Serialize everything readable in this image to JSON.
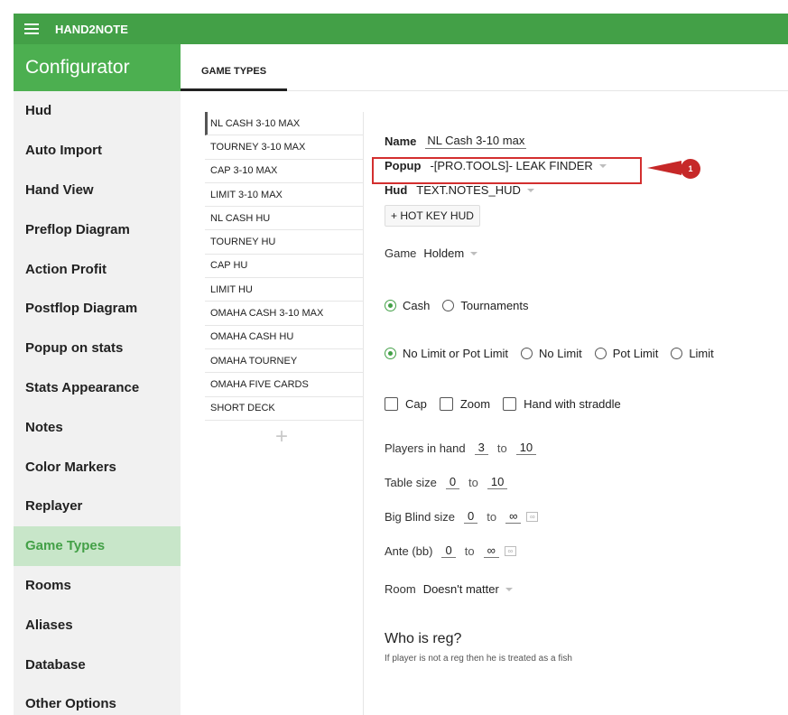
{
  "app": {
    "title": "HAND2NOTE"
  },
  "sidebar": {
    "title": "Configurator",
    "items": [
      {
        "label": "Hud"
      },
      {
        "label": "Auto Import"
      },
      {
        "label": "Hand View"
      },
      {
        "label": "Preflop Diagram"
      },
      {
        "label": "Action Profit"
      },
      {
        "label": "Postflop Diagram"
      },
      {
        "label": "Popup on stats"
      },
      {
        "label": "Stats Appearance"
      },
      {
        "label": "Notes"
      },
      {
        "label": "Color Markers"
      },
      {
        "label": "Replayer"
      },
      {
        "label": "Game Types",
        "active": true
      },
      {
        "label": "Rooms"
      },
      {
        "label": "Aliases"
      },
      {
        "label": "Database"
      },
      {
        "label": "Other Options"
      }
    ]
  },
  "tabs": [
    {
      "label": "GAME TYPES",
      "active": true
    }
  ],
  "game_types": [
    {
      "label": "NL CASH 3-10 MAX",
      "active": true
    },
    {
      "label": "TOURNEY 3-10 MAX"
    },
    {
      "label": "CAP 3-10 MAX"
    },
    {
      "label": "LIMIT 3-10 MAX"
    },
    {
      "label": "NL CASH HU"
    },
    {
      "label": "TOURNEY HU"
    },
    {
      "label": "CAP HU"
    },
    {
      "label": "LIMIT HU"
    },
    {
      "label": "OMAHA CASH 3-10 MAX"
    },
    {
      "label": "OMAHA CASH HU"
    },
    {
      "label": "OMAHA TOURNEY"
    },
    {
      "label": "OMAHA FIVE CARDS"
    },
    {
      "label": "SHORT DECK"
    }
  ],
  "add_symbol": "+",
  "form": {
    "name": {
      "label": "Name",
      "value": "NL Cash 3-10 max"
    },
    "popup": {
      "label": "Popup",
      "value": "-[PRO.TOOLS]- LEAK FINDER"
    },
    "hud": {
      "label": "Hud",
      "value": "TEXT.NOTES_HUD"
    },
    "hotkey_button": "+ HOT KEY HUD",
    "game": {
      "label": "Game",
      "value": "Holdem"
    },
    "type_options": [
      {
        "label": "Cash",
        "selected": true
      },
      {
        "label": "Tournaments",
        "selected": false
      }
    ],
    "limit_options": [
      {
        "label": "No Limit or Pot Limit",
        "selected": true
      },
      {
        "label": "No Limit",
        "selected": false
      },
      {
        "label": "Pot Limit",
        "selected": false
      },
      {
        "label": "Limit",
        "selected": false
      }
    ],
    "checkboxes": [
      {
        "label": "Cap",
        "checked": false
      },
      {
        "label": "Zoom",
        "checked": false
      },
      {
        "label": "Hand with straddle",
        "checked": false
      }
    ],
    "to_word": "to",
    "players_in_hand": {
      "label": "Players in hand",
      "min": "3",
      "max": "10"
    },
    "table_size": {
      "label": "Table size",
      "min": "0",
      "max": "10"
    },
    "big_blind_size": {
      "label": "Big Blind size",
      "min": "0",
      "max": "∞",
      "inf_icon": "∞"
    },
    "ante": {
      "label": "Ante (bb)",
      "min": "0",
      "max": "∞",
      "inf_icon": "∞"
    },
    "room": {
      "label": "Room",
      "value": "Doesn't matter"
    },
    "who_is_reg": {
      "title": "Who is reg?",
      "hint": "If player is not a reg then he is treated as a fish"
    }
  },
  "annotation": {
    "number": "1",
    "color": "#c62828"
  },
  "colors": {
    "brand_green": "#43a047",
    "header_green": "#4caf50",
    "active_bg": "#c8e6c9",
    "highlight_red": "#d32f2f"
  }
}
